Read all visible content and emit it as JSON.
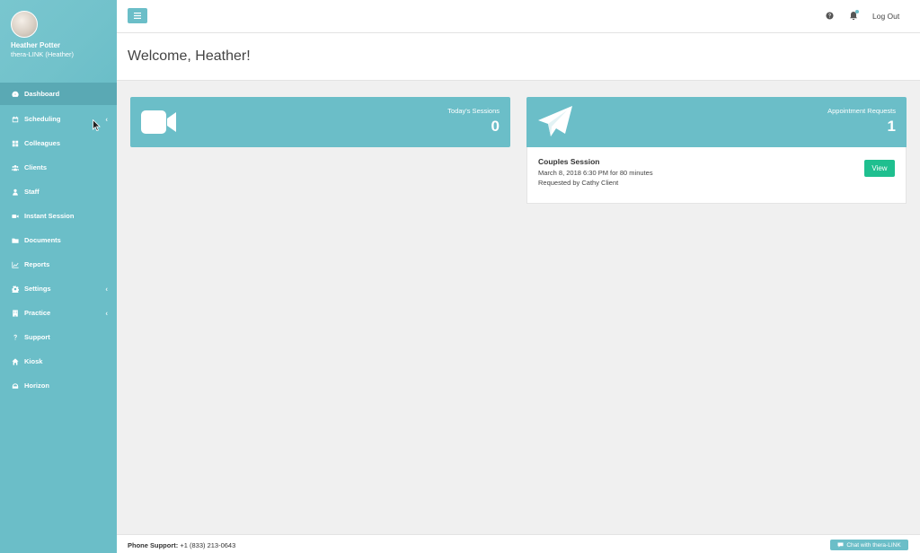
{
  "profile": {
    "name": "Heather Potter",
    "org": "thera-LINK (Heather)"
  },
  "sidebar": {
    "items": [
      {
        "label": "Dashboard",
        "icon": "dashboard-icon",
        "active": true,
        "arrow": false
      },
      {
        "label": "Scheduling",
        "icon": "calendar-icon",
        "active": false,
        "arrow": true
      },
      {
        "label": "Colleagues",
        "icon": "grid-icon",
        "active": false,
        "arrow": false
      },
      {
        "label": "Clients",
        "icon": "users-icon",
        "active": false,
        "arrow": false
      },
      {
        "label": "Staff",
        "icon": "user-icon",
        "active": false,
        "arrow": false
      },
      {
        "label": "Instant Session",
        "icon": "video-icon",
        "active": false,
        "arrow": false
      },
      {
        "label": "Documents",
        "icon": "folder-icon",
        "active": false,
        "arrow": false
      },
      {
        "label": "Reports",
        "icon": "chart-icon",
        "active": false,
        "arrow": false
      },
      {
        "label": "Settings",
        "icon": "gear-icon",
        "active": false,
        "arrow": true
      },
      {
        "label": "Practice",
        "icon": "building-icon",
        "active": false,
        "arrow": true
      },
      {
        "label": "Support",
        "icon": "question-icon",
        "active": false,
        "arrow": false
      },
      {
        "label": "Kiosk",
        "icon": "kiosk-icon",
        "active": false,
        "arrow": false
      },
      {
        "label": "Horizon",
        "icon": "horizon-icon",
        "active": false,
        "arrow": false
      }
    ],
    "arrow_glyph": "‹"
  },
  "topbar": {
    "logout_label": "Log Out"
  },
  "welcome": {
    "title": "Welcome, Heather!"
  },
  "sessions_card": {
    "label": "Today's Sessions",
    "count": "0"
  },
  "requests_card": {
    "label": "Appointment Requests",
    "count": "1"
  },
  "request": {
    "title": "Couples Session",
    "when": "March 8, 2018 6:30 PM for 80 minutes",
    "requested_by": "Requested by Cathy Client",
    "view_label": "View"
  },
  "footer": {
    "phone_label": "Phone Support:",
    "phone_number": "+1 (833) 213-0643",
    "chat_label": "Chat with thera-LINK"
  },
  "colors": {
    "accent": "#6bbec8",
    "accent_dark": "#5aa9b4",
    "success": "#1fbf8f"
  }
}
